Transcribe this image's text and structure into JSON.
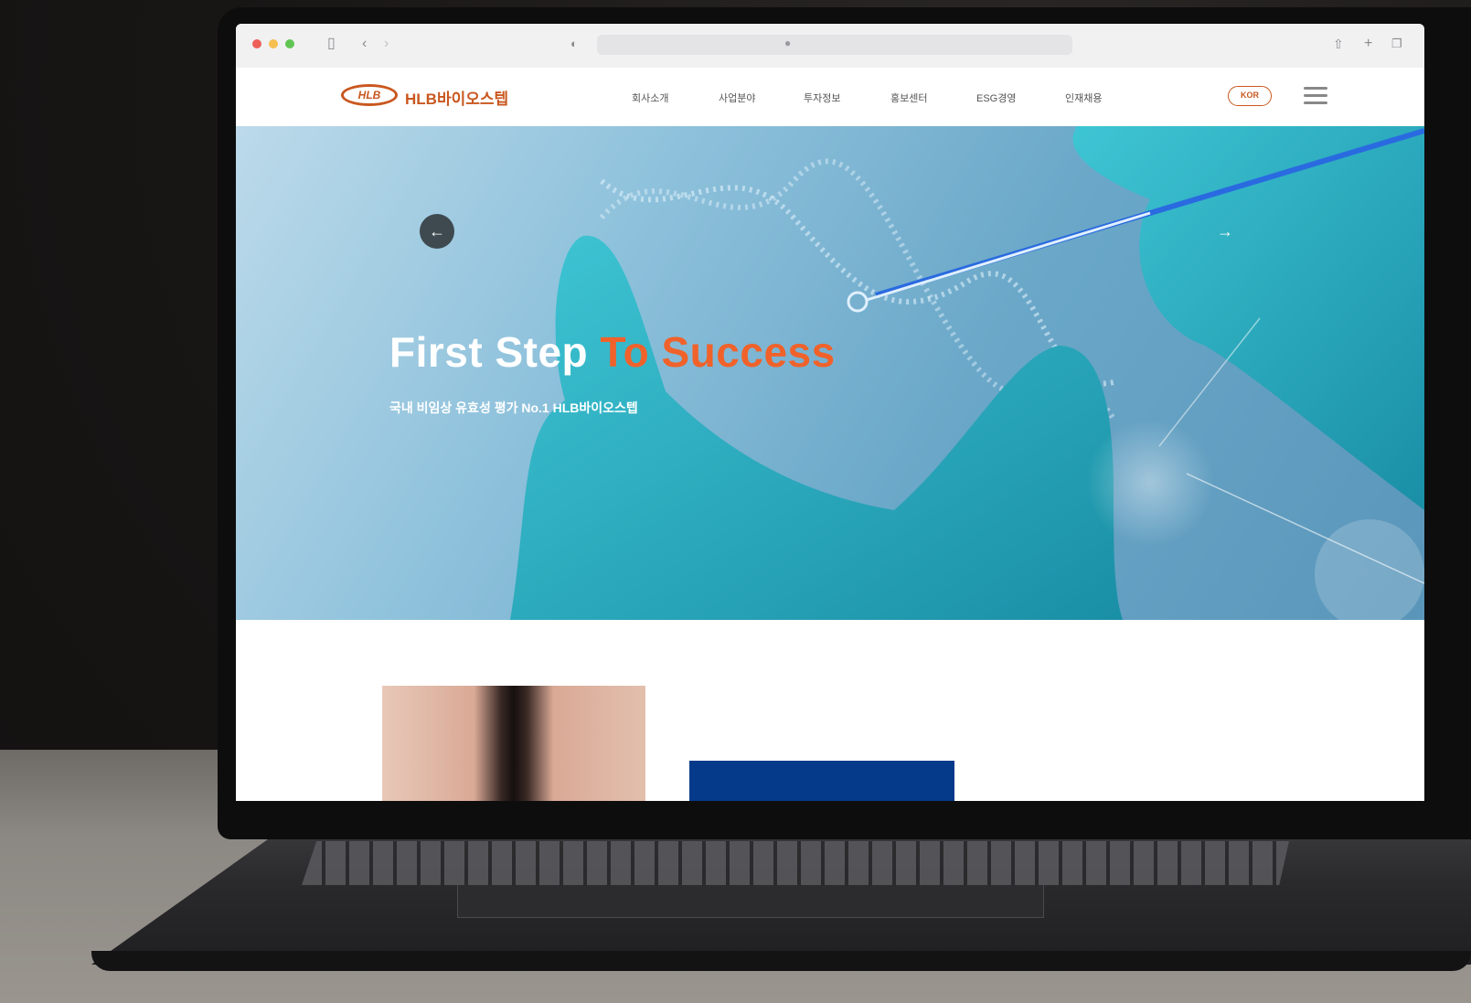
{
  "browser": {
    "window_controls": [
      "close",
      "minimize",
      "maximize"
    ],
    "toolbar_icons": [
      "sidebar-icon",
      "back-icon",
      "forward-icon",
      "privacy-icon",
      "share-icon",
      "new-tab-icon",
      "tabs-icon"
    ]
  },
  "site": {
    "logo_mark": "HLB",
    "logo_text": "HLB바이오스텝",
    "nav": [
      "회사소개",
      "사업분야",
      "투자정보",
      "홍보센터",
      "ESG경영",
      "인재채용"
    ],
    "lang_label": "KOR"
  },
  "hero": {
    "title_white": "First Step ",
    "title_orange": "To Success",
    "subtitle": "국내 비임상 유효성 평가 No.1 HLB바이오스텝",
    "prev_arrow": "←",
    "next_arrow": "→"
  },
  "colors": {
    "brand_orange": "#c9571f",
    "hero_accent": "#f0622a",
    "section_blue": "#053a8a"
  }
}
